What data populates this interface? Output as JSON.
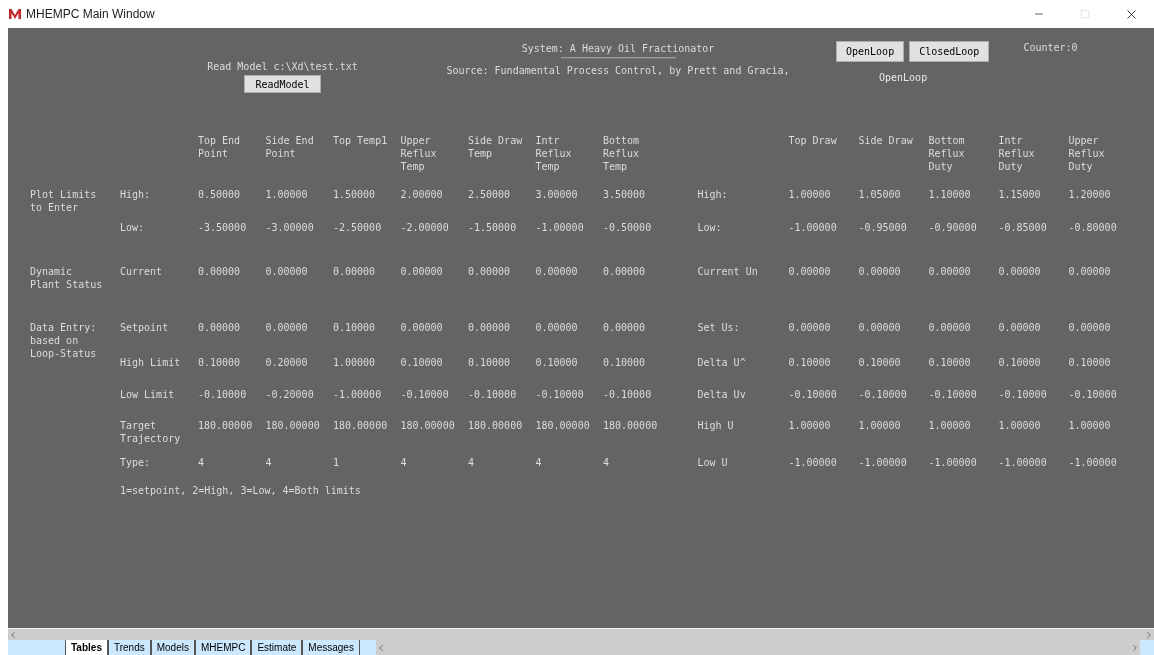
{
  "window": {
    "title": "MHEMPC Main Window"
  },
  "model": {
    "label": "Read Model c:\\Xd\\test.txt",
    "button": "ReadModel"
  },
  "system": {
    "title": "System: A Heavy Oil Fractionator",
    "underline": "~~~~~~~~~~~~~~~~~~~~~~~~~~~~~~~",
    "source": "Source: Fundamental Process Control, by Prett and Gracia,"
  },
  "loop_buttons": [
    {
      "label": "OpenLoop"
    },
    {
      "label": "ClosedLoop"
    }
  ],
  "loop_status": "OpenLoop",
  "counter": "Counter:0",
  "output_columns": [
    "Top End Point",
    "Side End Point",
    "Top Temp1",
    "Upper Reflux Temp",
    "Side Draw Temp",
    "Intr Reflux Temp",
    "Bottom Reflux Temp"
  ],
  "input_columns": [
    "Top Draw",
    "Side Draw",
    "Bottom Reflux Duty",
    "Intr Reflux Duty",
    "Upper Reflux Duty"
  ],
  "rows": [
    {
      "group": "Plot Limits to Enter",
      "label": "High:",
      "values": [
        "0.50000",
        "1.00000",
        "1.50000",
        "2.00000",
        "2.50000",
        "3.00000",
        "3.50000"
      ],
      "input_label": "High:",
      "input_values": [
        "1.00000",
        "1.05000",
        "1.10000",
        "1.15000",
        "1.20000"
      ]
    },
    {
      "label": "Low:",
      "values": [
        "-3.50000",
        "-3.00000",
        "-2.50000",
        "-2.00000",
        "-1.50000",
        "-1.00000",
        "-0.50000"
      ],
      "input_label": "Low:",
      "input_values": [
        "-1.00000",
        "-0.95000",
        "-0.90000",
        "-0.85000",
        "-0.80000"
      ]
    },
    {
      "group": "Dynamic Plant Status",
      "label": "Current",
      "values": [
        "0.00000",
        "0.00000",
        "0.00000",
        "0.00000",
        "0.00000",
        "0.00000",
        "0.00000"
      ],
      "input_label": "Current Un",
      "input_values": [
        "0.00000",
        "0.00000",
        "0.00000",
        "0.00000",
        "0.00000"
      ]
    },
    {
      "group": "Data Entry: based on Loop-Status",
      "label": "Setpoint",
      "values": [
        "0.00000",
        "0.00000",
        "0.10000",
        "0.00000",
        "0.00000",
        "0.00000",
        "0.00000"
      ],
      "input_label": "Set Us:",
      "input_values": [
        "0.00000",
        "0.00000",
        "0.00000",
        "0.00000",
        "0.00000"
      ]
    },
    {
      "label": "High Limit",
      "values": [
        "0.10000",
        "0.20000",
        "1.00000",
        "0.10000",
        "0.10000",
        "0.10000",
        "0.10000"
      ],
      "input_label": "Delta U^",
      "input_values": [
        "0.10000",
        "0.10000",
        "0.10000",
        "0.10000",
        "0.10000"
      ]
    },
    {
      "label": "Low Limit",
      "values": [
        "-0.10000",
        "-0.20000",
        "-1.00000",
        "-0.10000",
        "-0.10000",
        "-0.10000",
        "-0.10000"
      ],
      "input_label": "Delta Uv",
      "input_values": [
        "-0.10000",
        "-0.10000",
        "-0.10000",
        "-0.10000",
        "-0.10000"
      ]
    },
    {
      "label": "Target Trajectory",
      "values": [
        "180.00000",
        "180.00000",
        "180.00000",
        "180.00000",
        "180.00000",
        "180.00000",
        "180.00000"
      ],
      "input_label": "High U",
      "input_values": [
        "1.00000",
        "1.00000",
        "1.00000",
        "1.00000",
        "1.00000"
      ]
    },
    {
      "label": "Type:",
      "values": [
        "4",
        "4",
        "1",
        "4",
        "4",
        "4",
        "4"
      ],
      "input_label": "Low U",
      "input_values": [
        "-1.00000",
        "-1.00000",
        "-1.00000",
        "-1.00000",
        "-1.00000"
      ]
    }
  ],
  "note": "1=setpoint, 2=High, 3=Low, 4=Both limits",
  "tabs": [
    {
      "label": "Tables",
      "selected": true
    },
    {
      "label": "Trends",
      "selected": false
    },
    {
      "label": "Models",
      "selected": false
    },
    {
      "label": "MHEMPC",
      "selected": false
    },
    {
      "label": "Estimate",
      "selected": false
    },
    {
      "label": "Messages",
      "selected": false
    }
  ]
}
